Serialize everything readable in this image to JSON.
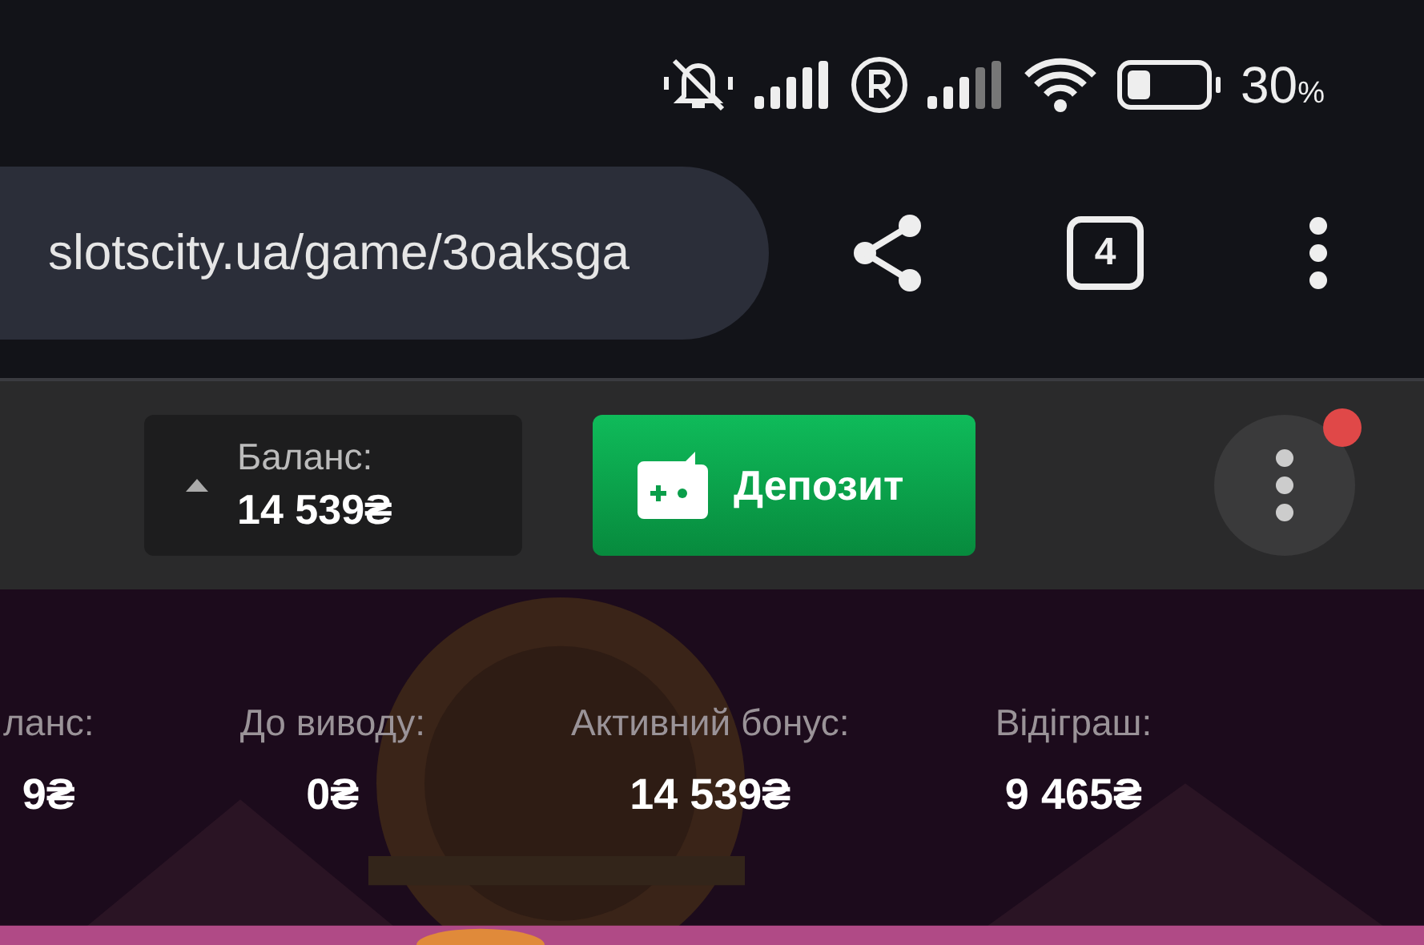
{
  "status_bar": {
    "battery_text": "30",
    "battery_unit": "%"
  },
  "browser": {
    "url": "slotscity.ua/game/3oaksga",
    "tab_count": "4"
  },
  "header": {
    "balance_label": "Баланс:",
    "balance_value": "14 539₴",
    "deposit_button": "Депозит",
    "notification": true
  },
  "game": {
    "kind": "picture",
    "stats": [
      {
        "label": "ланс:",
        "value": "9₴"
      },
      {
        "label": "До виводу:",
        "value": "0₴"
      },
      {
        "label": "Активний бонус:",
        "value": "14 539₴"
      },
      {
        "label": "Відіграш:",
        "value": "9 465₴"
      }
    ]
  }
}
